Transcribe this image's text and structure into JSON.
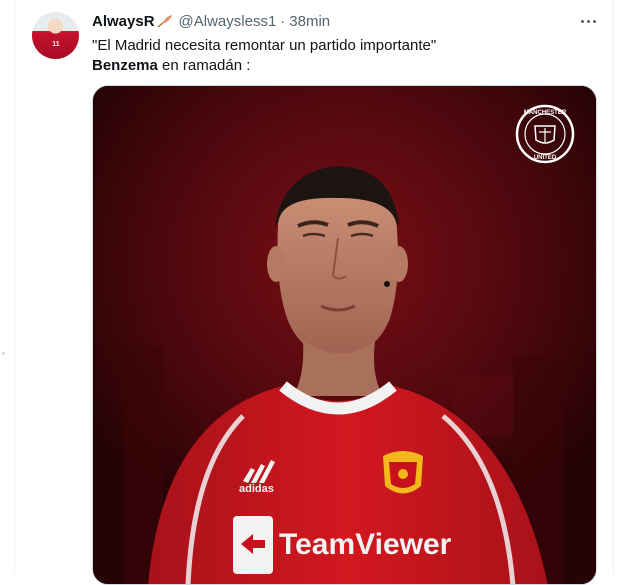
{
  "tweet": {
    "display_name": "AlwaysR",
    "handle": "@Alwaysless1",
    "separator": "·",
    "time": "38min",
    "line1": "\"El Madrid necesita remontar un partido importante\"",
    "line2_bold": "Benzema",
    "line2_rest": " en ramadán :",
    "avatar_number": "11"
  },
  "media": {
    "crest_top_text": "MANCHESTER",
    "crest_bottom_text": "UNITED",
    "shirt_brand": "adidas",
    "sponsor": "TeamViewer"
  },
  "colors": {
    "text_primary": "#0f1419",
    "text_secondary": "#536471",
    "border": "#cfd9de",
    "shirt_red": "#d3171f"
  },
  "icons": [
    "feather-icon",
    "more-icon",
    "club-crest-icon"
  ]
}
